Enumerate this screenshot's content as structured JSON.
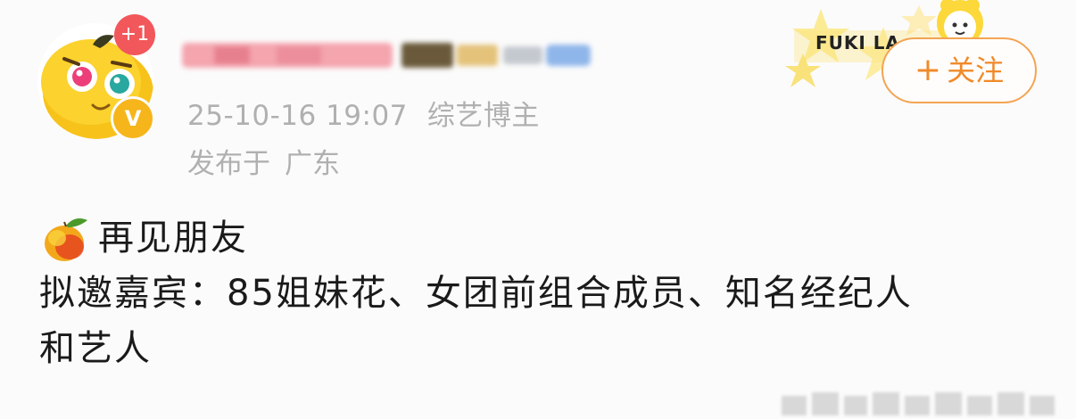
{
  "post": {
    "notification_count": "+1",
    "verified_mark": "V",
    "timestamp": "25-10-16 19:07",
    "author_tag": "综艺博主",
    "location_prefix": "发布于",
    "location": "广东",
    "follow_label": "关注",
    "follow_plus": "+",
    "decoration_text": "FUKI LA",
    "content": {
      "title": "再见朋友",
      "line1": "拟邀嘉宾：85姐妹花、女团前组合成员、知名经纪人",
      "line2": "和艺人"
    }
  },
  "colors": {
    "accent_orange": "#f08a2a",
    "badge_red": "#f2575b",
    "verify_gold": "#f6b51a",
    "meta_gray": "#b0b0b0"
  },
  "icons": [
    "avatar-mango-character",
    "verified-icon",
    "mango-icon",
    "star-decoration"
  ]
}
